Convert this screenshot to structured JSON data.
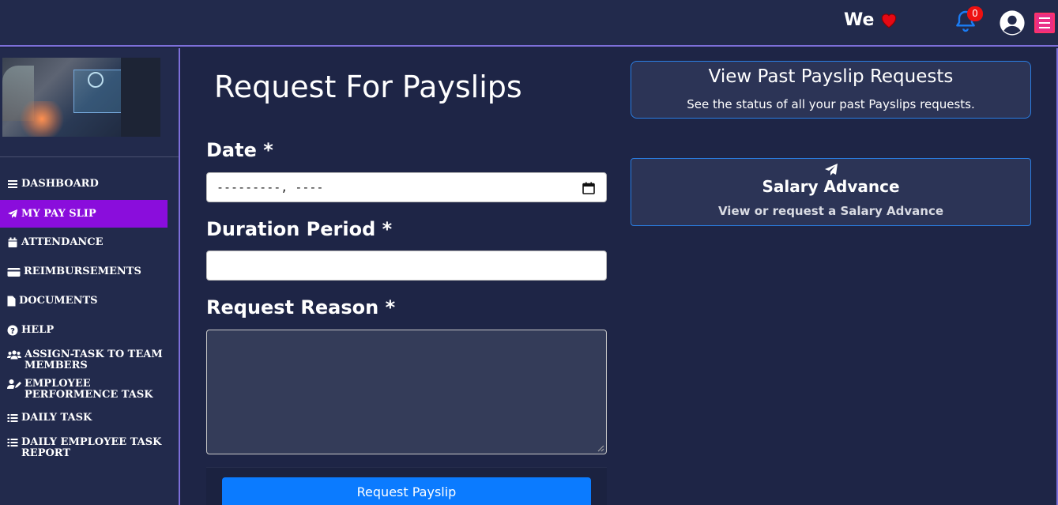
{
  "header": {
    "brand_text": "We",
    "notification_count": "0",
    "colors": {
      "bar": "#222a4c",
      "accent": "#7d6fd9",
      "menu": "#ea2f86"
    }
  },
  "sidebar": {
    "active_color": "#8a0ddc",
    "items": [
      {
        "label": "DASHBOARD",
        "icon": "bars-icon"
      },
      {
        "label": "MY PAY SLIP",
        "icon": "paper-plane-icon"
      },
      {
        "label": "ATTENDANCE",
        "icon": "calendar-icon"
      },
      {
        "label": "REIMBURSEMENTS",
        "icon": "credit-card-icon"
      },
      {
        "label": "DOCUMENTS",
        "icon": "file-icon"
      },
      {
        "label": "HELP",
        "icon": "question-circle-icon"
      },
      {
        "label": "ASSIGN-TASK TO TEAM MEMBERS",
        "icon": "users-icon"
      },
      {
        "label": "EMPLOYEE PERFORMENCE TASK",
        "icon": "user-edit-icon"
      },
      {
        "label": "DAILY TASK",
        "icon": "list-icon"
      },
      {
        "label": "DAILY EMPLOYEE TASK REPORT",
        "icon": "list-icon"
      }
    ]
  },
  "form": {
    "title": "Request For Payslips",
    "date_label": "Date *",
    "date_placeholder": "---------, ----",
    "duration_label": "Duration Period *",
    "duration_value": "",
    "reason_label": "Request Reason *",
    "reason_value": "",
    "submit_label": "Request Payslip"
  },
  "cards": {
    "past_requests": {
      "title": "View Past Payslip Requests",
      "subtitle": "See the status of all your past Payslips requests."
    },
    "salary_advance": {
      "title": "Salary Advance",
      "subtitle": "View or request a Salary Advance",
      "icon": "paper-plane-icon"
    }
  }
}
